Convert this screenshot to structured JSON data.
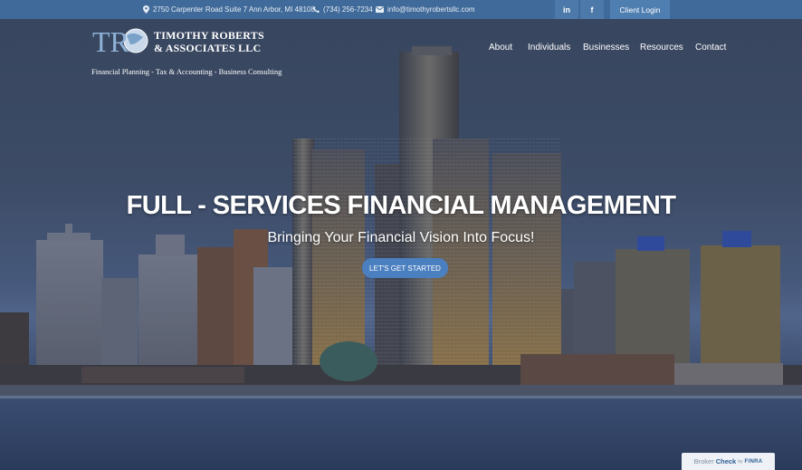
{
  "topbar": {
    "address": "2750 Carpenter Road Suite 7 Ann Arbor, MI 48108",
    "phone": "(734) 256-7234",
    "email": "info@timothyrobertsllc.com",
    "linkedin": "in",
    "facebook": "f",
    "client_login": "Client Login"
  },
  "logo": {
    "monogram": "TR",
    "name_line1": "TIMOTHY ROBERTS",
    "name_line2": "& ASSOCIATES LLC",
    "tagline": "Financial Planning - Tax & Accounting - Business Consulting"
  },
  "nav": {
    "items": [
      "About",
      "Individuals",
      "Businesses",
      "Resources",
      "Contact"
    ]
  },
  "hero": {
    "headline": "FULL - SERVICES FINANCIAL MANAGEMENT",
    "subline": "Bringing Your Financial Vision Into Focus!",
    "cta": "LET'S GET STARTED"
  },
  "brokercheck": {
    "broker": "Broker",
    "check": "Check",
    "by": "by",
    "finra": "FINRA"
  },
  "colors": {
    "topbar": "#3f6a99",
    "button": "#4a7fc0",
    "water": "#2c3d5e"
  }
}
